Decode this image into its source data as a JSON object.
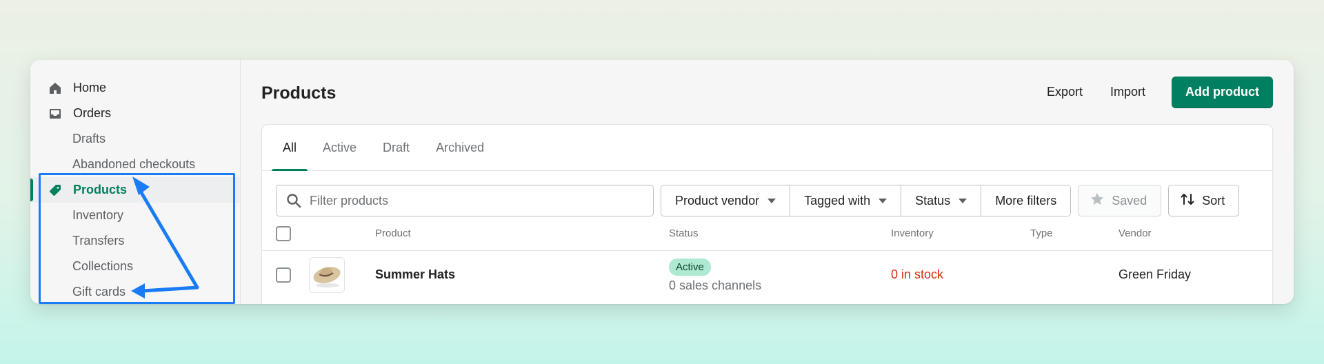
{
  "sidebar": {
    "items": [
      {
        "label": "Home",
        "icon": "home-icon"
      },
      {
        "label": "Orders",
        "icon": "inbox-icon"
      },
      {
        "label": "Drafts"
      },
      {
        "label": "Abandoned checkouts"
      },
      {
        "label": "Products",
        "icon": "tag-icon"
      },
      {
        "label": "Inventory"
      },
      {
        "label": "Transfers"
      },
      {
        "label": "Collections"
      },
      {
        "label": "Gift cards"
      }
    ]
  },
  "header": {
    "title": "Products",
    "export_label": "Export",
    "import_label": "Import",
    "add_label": "Add product"
  },
  "tabs": [
    "All",
    "Active",
    "Draft",
    "Archived"
  ],
  "filters": {
    "search_placeholder": "Filter products",
    "vendor": "Product vendor",
    "tagged": "Tagged with",
    "status": "Status",
    "more": "More filters",
    "saved": "Saved",
    "sort": "Sort"
  },
  "table": {
    "columns": [
      "Product",
      "Status",
      "Inventory",
      "Type",
      "Vendor"
    ],
    "rows": [
      {
        "product": "Summer Hats",
        "status": "Active",
        "channels": "0 sales channels",
        "inventory": "0 in stock",
        "type": "",
        "vendor": "Green Friday"
      }
    ]
  },
  "colors": {
    "accent": "#008060",
    "highlight": "#1a7cf5",
    "out_of_stock": "#d82c0d",
    "badge_bg": "#aee9d1"
  }
}
